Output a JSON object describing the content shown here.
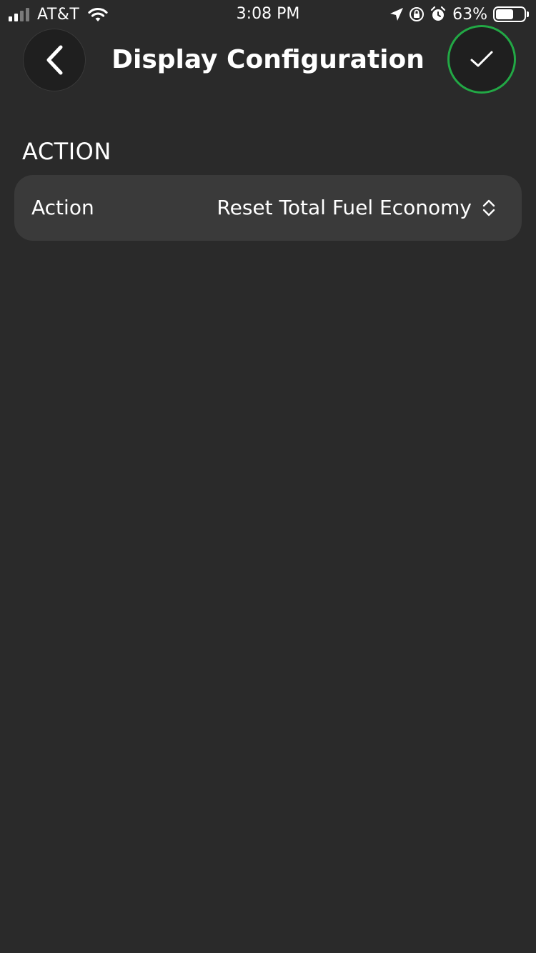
{
  "status_bar": {
    "carrier": "AT&T",
    "time": "3:08 PM",
    "battery_percent": "63%",
    "icons": [
      "signal-icon",
      "wifi-icon",
      "location-arrow-icon",
      "orientation-lock-icon",
      "alarm-icon",
      "battery-icon"
    ]
  },
  "nav": {
    "title": "Display Configuration",
    "back_icon": "chevron-left-icon",
    "confirm_icon": "checkmark-icon"
  },
  "section": {
    "header": "ACTION",
    "row": {
      "label": "Action",
      "value": "Reset Total Fuel Economy",
      "icon": "up-down-chevron-icon"
    }
  },
  "colors": {
    "background": "#2a2a2a",
    "row_background": "#3a3a3a",
    "confirm_ring": "#22a845",
    "text": "#ffffff"
  }
}
